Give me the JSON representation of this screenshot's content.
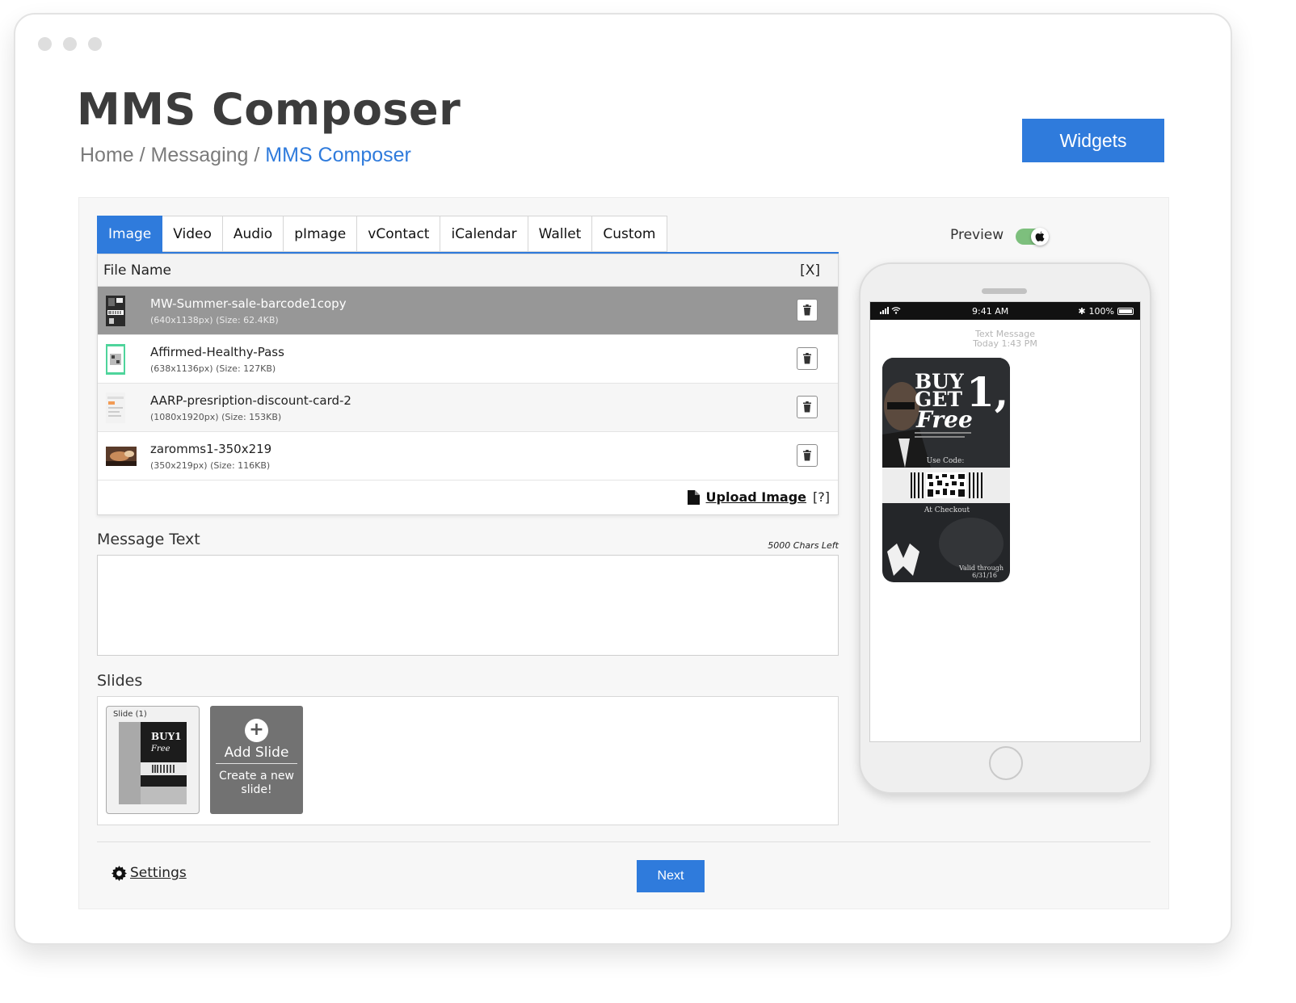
{
  "page": {
    "title": "MMS Composer",
    "breadcrumb": {
      "home": "Home",
      "sep1": " / ",
      "section": "Messaging",
      "sep2": " / ",
      "current": "MMS Composer"
    },
    "widgets_label": "Widgets"
  },
  "tabs": [
    {
      "label": "Image",
      "active": true
    },
    {
      "label": "Video"
    },
    {
      "label": "Audio"
    },
    {
      "label": "pImage"
    },
    {
      "label": "vContact"
    },
    {
      "label": "iCalendar"
    },
    {
      "label": "Wallet"
    },
    {
      "label": "Custom"
    }
  ],
  "files": {
    "header": "File Name",
    "close": "[X]",
    "rows": [
      {
        "name": "MW-Summer-sale-barcode1copy",
        "meta": "(640x1138px) (Size: 62.4KB)",
        "selected": true
      },
      {
        "name": "Affirmed-Healthy-Pass",
        "meta": "(638x1136px) (Size: 127KB)"
      },
      {
        "name": "AARP-presription-discount-card-2",
        "meta": "(1080x1920px) (Size: 153KB)"
      },
      {
        "name": "zaromms1-350x219",
        "meta": "(350x219px) (Size: 116KB)"
      }
    ],
    "upload_label": "Upload Image",
    "help": "[?]"
  },
  "message": {
    "label": "Message Text",
    "chars_left": "5000 Chars Left",
    "value": ""
  },
  "slides": {
    "label": "Slides",
    "items": [
      {
        "label": "Slide (1)"
      }
    ],
    "add_title": "Add Slide",
    "add_desc": "Create a new slide!"
  },
  "footer": {
    "settings_label": "Settings",
    "next_label": "Next"
  },
  "preview": {
    "label": "Preview",
    "enabled": true,
    "status_time": "9:41 AM",
    "battery": "100%",
    "msg_type": "Text Message",
    "msg_time": "Today 1:43 PM",
    "promo": {
      "line1": "BUY",
      "big": "1,",
      "line2": "GET",
      "line3": "Free",
      "use_code": "Use Code:",
      "at_checkout": "At Checkout",
      "valid": "Valid through",
      "valid_date": "6/31/16"
    }
  },
  "colors": {
    "accent": "#2f7bdc",
    "selected_row": "#979797",
    "toggle_on": "#7dbf7d"
  }
}
